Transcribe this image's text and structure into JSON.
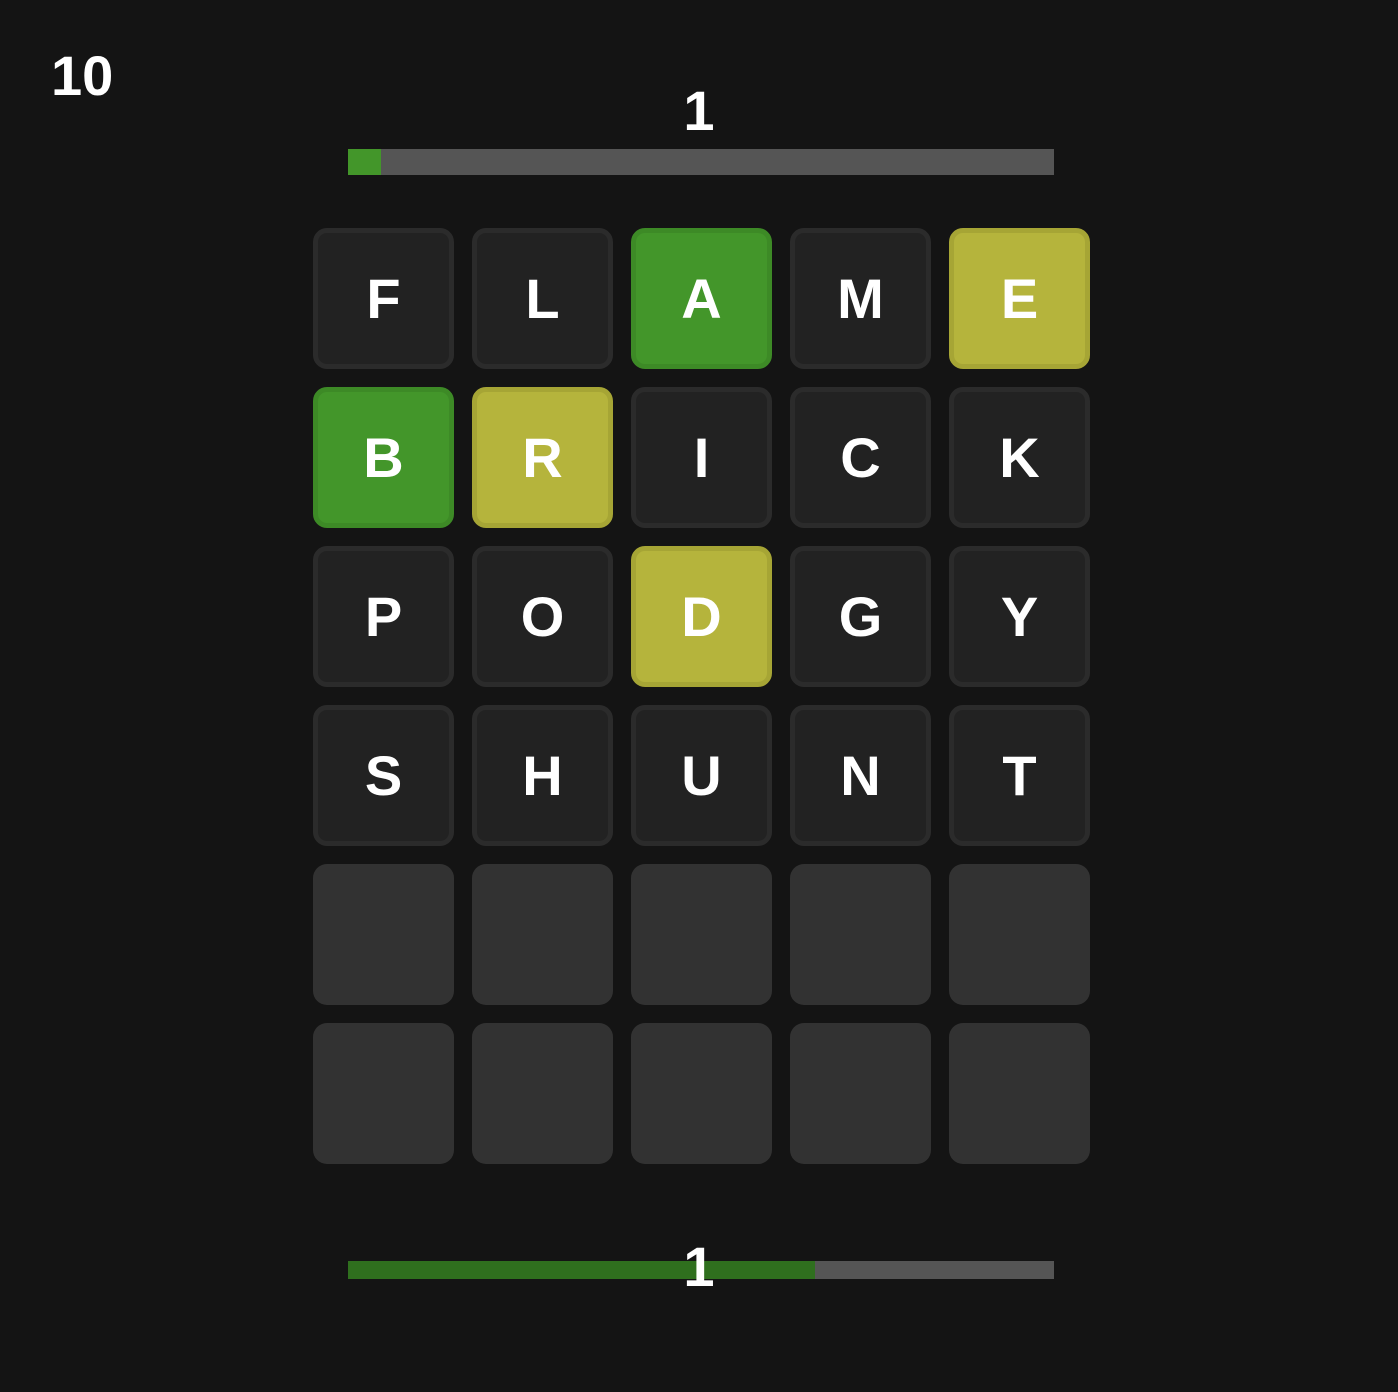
{
  "score": "10",
  "top_number": "1",
  "bottom_number": "1",
  "progress": {
    "top_fraction": 0.047,
    "bottom_fraction": 0.661
  },
  "colors": {
    "background": "#141414",
    "correct": "#43962a",
    "present": "#b5b43c",
    "absent": "#222222",
    "empty": "#323232",
    "bar_track": "#555555"
  },
  "board": {
    "rows": [
      {
        "tiles": [
          {
            "letter": "F",
            "state": "absent"
          },
          {
            "letter": "L",
            "state": "absent"
          },
          {
            "letter": "A",
            "state": "correct"
          },
          {
            "letter": "M",
            "state": "absent"
          },
          {
            "letter": "E",
            "state": "present"
          }
        ]
      },
      {
        "tiles": [
          {
            "letter": "B",
            "state": "correct"
          },
          {
            "letter": "R",
            "state": "present"
          },
          {
            "letter": "I",
            "state": "absent"
          },
          {
            "letter": "C",
            "state": "absent"
          },
          {
            "letter": "K",
            "state": "absent"
          }
        ]
      },
      {
        "tiles": [
          {
            "letter": "P",
            "state": "absent"
          },
          {
            "letter": "O",
            "state": "absent"
          },
          {
            "letter": "D",
            "state": "present"
          },
          {
            "letter": "G",
            "state": "absent"
          },
          {
            "letter": "Y",
            "state": "absent"
          }
        ]
      },
      {
        "tiles": [
          {
            "letter": "S",
            "state": "absent"
          },
          {
            "letter": "H",
            "state": "absent"
          },
          {
            "letter": "U",
            "state": "absent"
          },
          {
            "letter": "N",
            "state": "absent"
          },
          {
            "letter": "T",
            "state": "absent"
          }
        ]
      },
      {
        "tiles": [
          {
            "letter": "",
            "state": "empty"
          },
          {
            "letter": "",
            "state": "empty"
          },
          {
            "letter": "",
            "state": "empty"
          },
          {
            "letter": "",
            "state": "empty"
          },
          {
            "letter": "",
            "state": "empty"
          }
        ]
      },
      {
        "tiles": [
          {
            "letter": "",
            "state": "empty"
          },
          {
            "letter": "",
            "state": "empty"
          },
          {
            "letter": "",
            "state": "empty"
          },
          {
            "letter": "",
            "state": "empty"
          },
          {
            "letter": "",
            "state": "empty"
          }
        ]
      }
    ]
  }
}
